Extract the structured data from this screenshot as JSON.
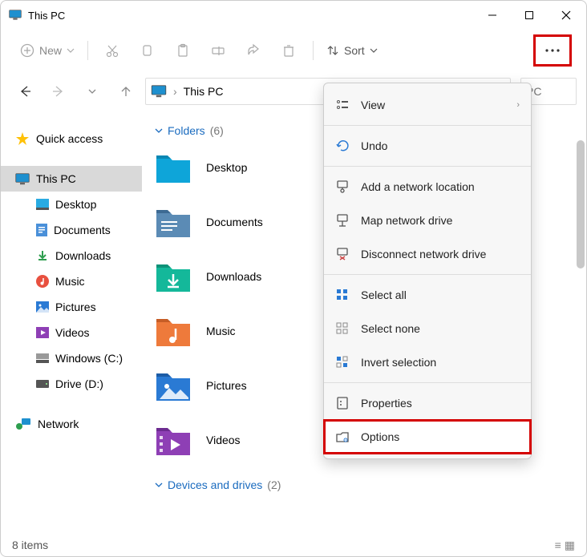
{
  "window": {
    "title": "This PC",
    "min": "−",
    "max": "□",
    "close": "✕"
  },
  "toolbar": {
    "new_label": "New",
    "sort_label": "Sort"
  },
  "breadcrumb": {
    "root": "This PC"
  },
  "search": {
    "hint": "PC"
  },
  "sidebar": {
    "quick": "Quick access",
    "thispc": "This PC",
    "items": [
      {
        "label": "Desktop"
      },
      {
        "label": "Documents"
      },
      {
        "label": "Downloads"
      },
      {
        "label": "Music"
      },
      {
        "label": "Pictures"
      },
      {
        "label": "Videos"
      },
      {
        "label": "Windows (C:)"
      },
      {
        "label": "Drive (D:)"
      }
    ],
    "network": "Network"
  },
  "main": {
    "group_folders": "Folders",
    "folders_count": "(6)",
    "folders": [
      {
        "label": "Desktop"
      },
      {
        "label": "Documents"
      },
      {
        "label": "Downloads"
      },
      {
        "label": "Music"
      },
      {
        "label": "Pictures"
      },
      {
        "label": "Videos"
      }
    ],
    "group_devices": "Devices and drives",
    "devices_count": "(2)"
  },
  "menu": {
    "view": "View",
    "undo": "Undo",
    "add_net": "Add a network location",
    "map_drive": "Map network drive",
    "disc_drive": "Disconnect network drive",
    "select_all": "Select all",
    "select_none": "Select none",
    "invert": "Invert selection",
    "properties": "Properties",
    "options": "Options"
  },
  "status": {
    "items": "8 items"
  }
}
